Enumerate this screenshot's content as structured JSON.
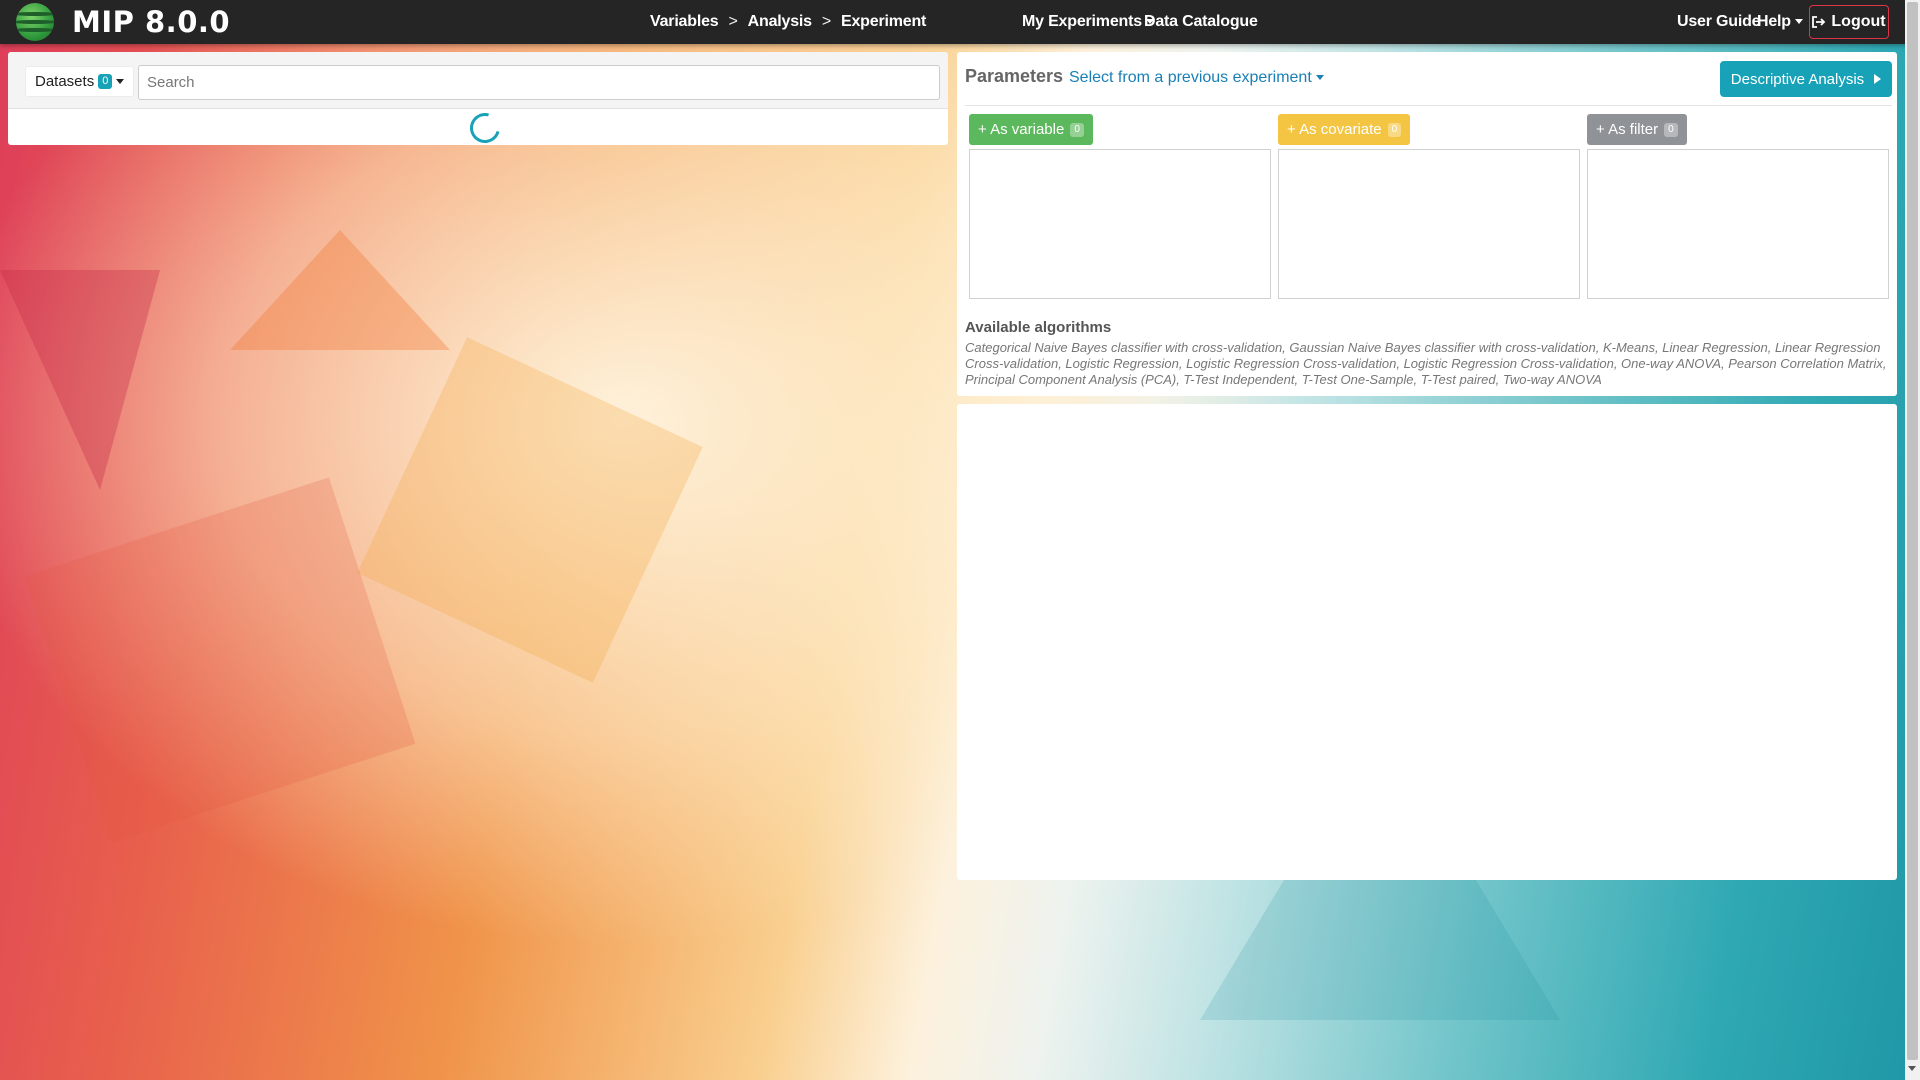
{
  "navbar": {
    "brand": "MIP 8.0.0",
    "breadcrumbs": [
      {
        "label": "Variables"
      },
      {
        "label": "Analysis"
      },
      {
        "label": "Experiment"
      }
    ],
    "separator": ">",
    "my_experiments": "My Experiments",
    "data_catalogue": "Data Catalogue",
    "user_guide": "User Guide",
    "help": "Help",
    "logout": "Logout"
  },
  "left_panel": {
    "datasets_label": "Datasets",
    "datasets_count": "0",
    "search_placeholder": "Search",
    "search_value": ""
  },
  "parameters": {
    "title": "Parameters",
    "select_previous": "Select from a previous experiment",
    "descriptive_button": "Descriptive Analysis",
    "variable_label": "+ As variable",
    "variable_count": "0",
    "covariate_label": "+ As covariate",
    "covariate_count": "0",
    "filter_label": "+ As filter",
    "filter_count": "0",
    "algorithms_title": "Available algorithms",
    "algorithms_text": "Categorical Naive Bayes classifier with cross-validation, Gaussian Naive Bayes classifier with cross-validation, K-Means, Linear Regression, Linear Regression Cross-validation, Logistic Regression, Logistic Regression Cross-validation, Logistic Regression Cross-validation, One-way ANOVA, Pearson Correlation Matrix, Principal Component Analysis (PCA), T-Test Independent, T-Test One-Sample, T-Test paired, Two-way ANOVA"
  },
  "colors": {
    "navbar_bg": "#252525",
    "info": "#17a2b8",
    "success": "#5cb85c",
    "warning": "#f4c542",
    "secondary": "#8f9296",
    "danger": "#dc3545",
    "link": "#1a7fb5"
  },
  "icons": {
    "logo": "mip-globe-logo",
    "logout": "sign-out-icon",
    "descriptive": "play-icon",
    "loading": "spinner-icon"
  }
}
